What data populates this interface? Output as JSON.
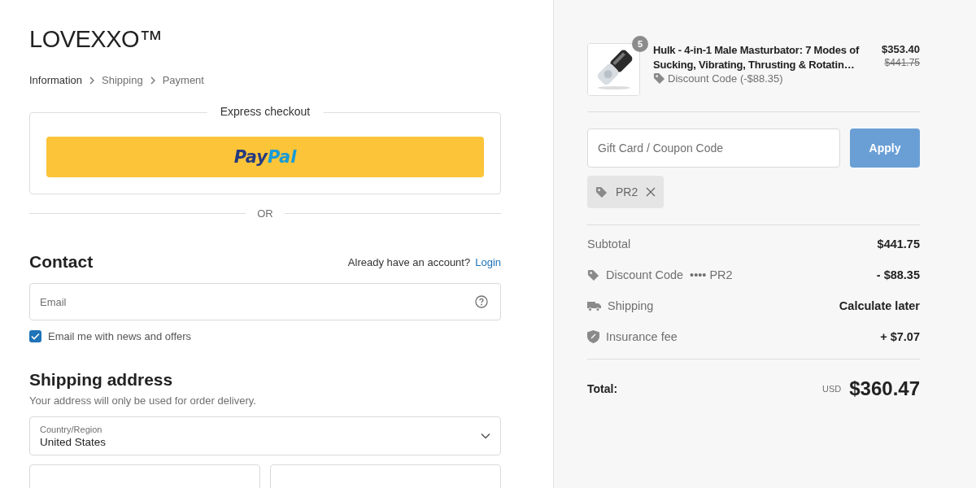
{
  "store": {
    "logo": "LOVEXXO™"
  },
  "breadcrumbs": [
    {
      "label": "Information",
      "selected": true
    },
    {
      "label": "Shipping",
      "selected": false
    },
    {
      "label": "Payment",
      "selected": false
    }
  ],
  "express": {
    "title": "Express checkout",
    "paypal": {
      "part_1": "Pay",
      "part_2": "Pal"
    },
    "divider": "OR"
  },
  "contact": {
    "title": "Contact",
    "account_prompt": "Already have an account?",
    "login": "Login",
    "email": {
      "placeholder": "Email"
    },
    "newsletter": {
      "label": "Email me with news and offers",
      "checked": true
    }
  },
  "shipping_address": {
    "title": "Shipping address",
    "note": "Your address will only be used for order delivery.",
    "country": {
      "label": "Country/Region",
      "value": "United States"
    }
  },
  "order": {
    "item": {
      "kind": "picture",
      "quantity": "5",
      "name": "Hulk - 4-in-1 Male Masturbator: 7 Modes of Sucking, Vibrating, Thrusting & Rotatin…",
      "discount": "Discount Code (-$88.35)",
      "price": "$353.40",
      "original_price": "$441.75"
    },
    "coupon": {
      "placeholder": "Gift Card / Coupon Code",
      "button": "Apply"
    },
    "applied_codes": [
      {
        "code": "PR2"
      }
    ],
    "lines": [
      {
        "kind": "plain",
        "label": "Subtotal",
        "value": "$441.75"
      },
      {
        "kind": "discount",
        "label": "Discount Code",
        "code": "•••• PR2",
        "value": "- $88.35"
      },
      {
        "kind": "shipping",
        "label": "Shipping",
        "value": "Calculate later"
      },
      {
        "kind": "insurance",
        "label": "Insurance fee",
        "value": "+ $7.07"
      }
    ],
    "total": {
      "label": "Total:",
      "currency": "USD",
      "amount": "$360.47"
    }
  }
}
